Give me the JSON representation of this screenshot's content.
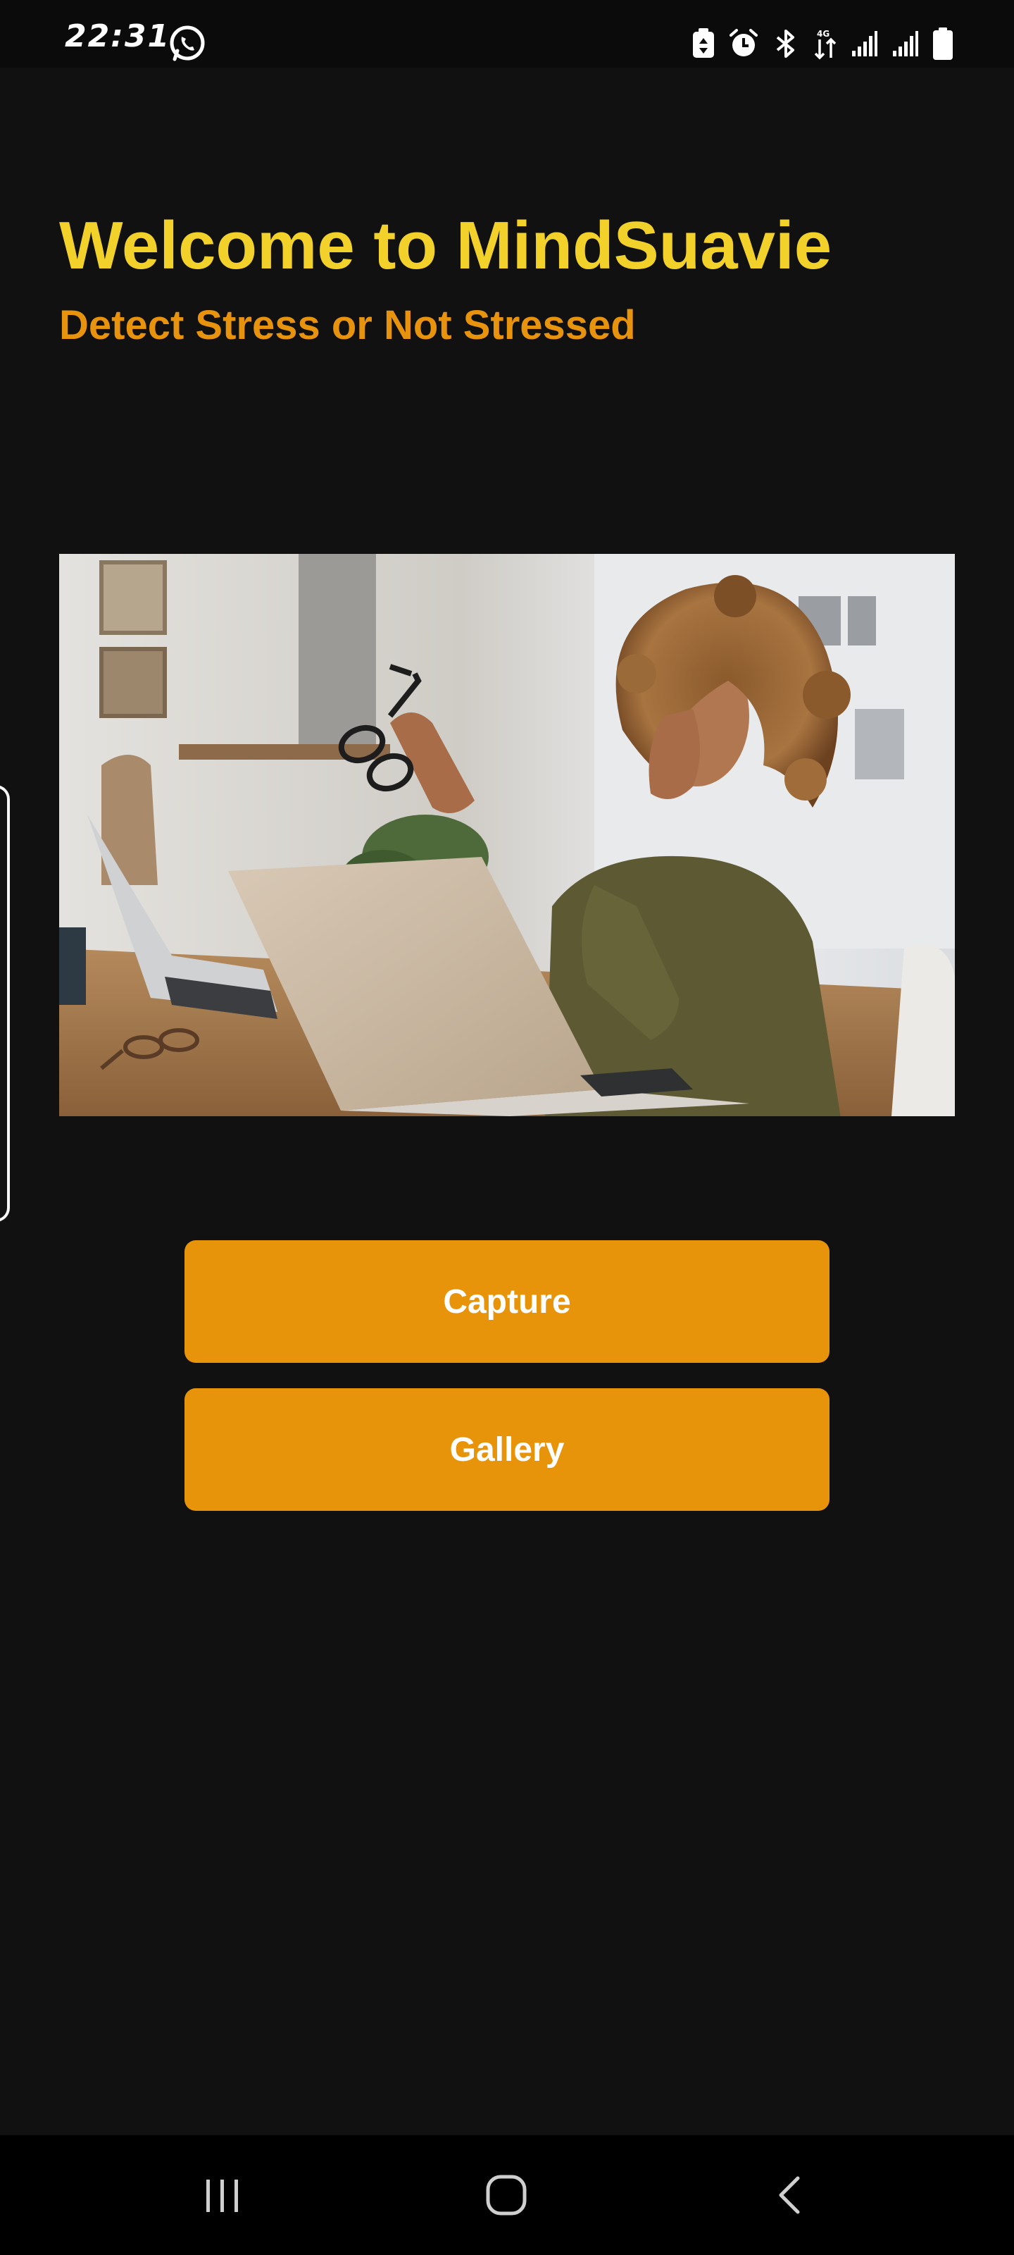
{
  "status_bar": {
    "time": "22:31",
    "left_icons": [
      "whatsapp-icon"
    ],
    "right_icons": [
      "battery-saver-icon",
      "alarm-icon",
      "bluetooth-icon",
      "data-transfer-icon",
      "signal-icon",
      "signal-icon",
      "battery-icon"
    ]
  },
  "header": {
    "title": "Welcome to MindSuavie",
    "subtitle": "Detect Stress or Not Stressed",
    "title_color": "#f2d22a",
    "subtitle_color": "#e8930e"
  },
  "hero_image": {
    "subject": "stressed woman at laptop"
  },
  "actions": {
    "capture_label": "Capture",
    "gallery_label": "Gallery",
    "button_color": "#e8940b"
  },
  "nav_bar": {
    "buttons": [
      "recents-icon",
      "home-icon",
      "back-icon"
    ]
  },
  "colors": {
    "background": "#111112",
    "status_bar": "#0b0b0c",
    "nav_bar": "#000000"
  }
}
